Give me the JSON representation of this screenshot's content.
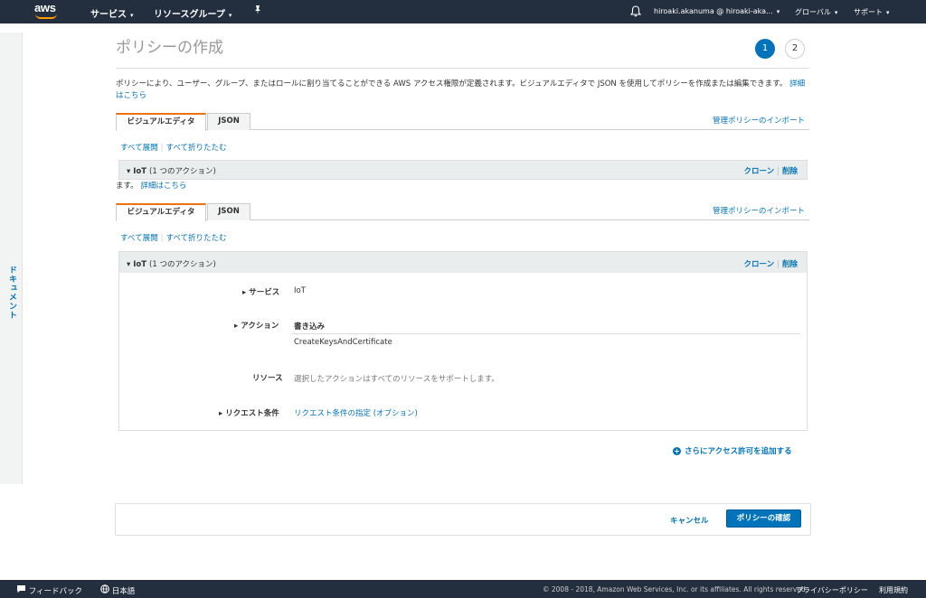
{
  "topnav": {
    "logo_text": "aws",
    "services_label": "サービス",
    "resource_groups_label": "リソースグループ",
    "pin_icon": "pin-icon",
    "bell_icon": "bell-icon",
    "account_label": "hiroaki.akanuma @ hiroaki-aka...",
    "region_label": "グローバル",
    "support_label": "サポート"
  },
  "side": {
    "doc_label": "ドキュメント"
  },
  "page": {
    "title": "ポリシーの作成",
    "step1": "1",
    "step2": "2",
    "description": "ポリシーにより、ユーザー、グループ、またはロールに割り当てることができる AWS アクセス権限が定義されます。ビジュアルエディタで JSON を使用してポリシーを作成または編集できます。",
    "details_link": "詳細はこちら",
    "desc_continuation": "ます。",
    "tab_visual": "ビジュアルエディタ",
    "tab_json": "JSON",
    "import_link": "管理ポリシーのインポート",
    "expand_all": "すべて展開",
    "collapse_all": "すべて折りたたむ",
    "statement_service": "IoT",
    "statement_count": "(1 つのアクション)",
    "clone_label": "クローン",
    "delete_label": "削除"
  },
  "statement": {
    "service_label": "サービス",
    "service_value": "IoT",
    "action_label": "アクション",
    "action_group": "書き込み",
    "action_value": "CreateKeysAndCertificate",
    "resource_label": "リソース",
    "resource_value": "選択したアクションはすべてのリソースをサポートします。",
    "condition_label": "リクエスト条件",
    "condition_value": "リクエスト条件の指定 (オプション)"
  },
  "add_permissions": "さらにアクセス許可を追加する",
  "footer": {
    "cancel_label": "キャンセル",
    "confirm_label": "ポリシーの確認"
  },
  "bottombar": {
    "feedback_label": "フィードバック",
    "language_label": "日本語",
    "copyright": "© 2008 - 2018, Amazon Web Services, Inc. or its affiliates. All rights reserved.",
    "privacy_label": "プライバシーポリシー",
    "terms_label": "利用規約"
  }
}
